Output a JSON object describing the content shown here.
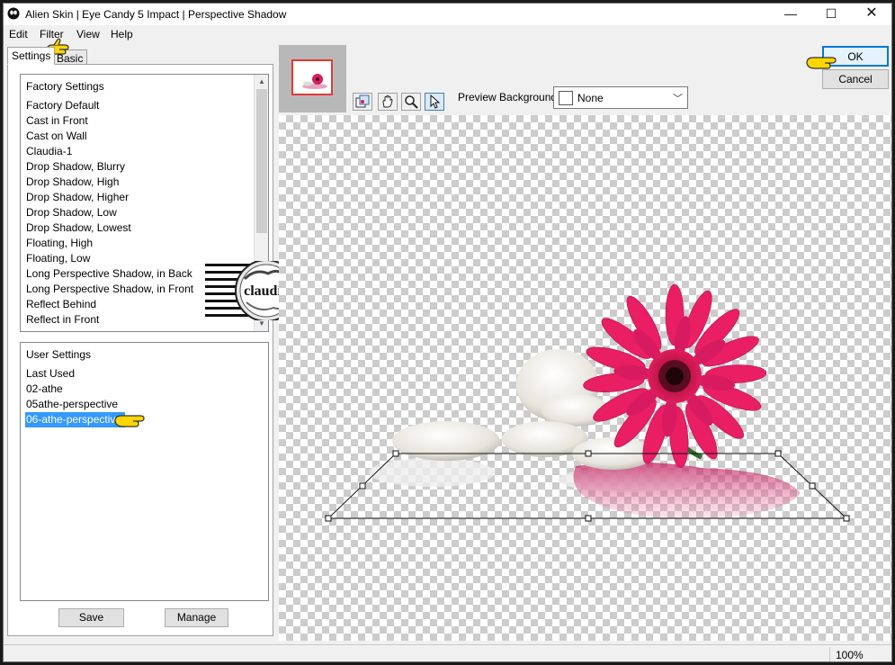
{
  "window": {
    "title": "Alien Skin | Eye Candy 5 Impact | Perspective Shadow",
    "minimize_glyph": "—",
    "maximize_glyph": "☐",
    "close_glyph": "✕"
  },
  "menu": {
    "items": [
      "Edit",
      "Filter",
      "View",
      "Help"
    ]
  },
  "tabs": [
    "Settings",
    "Basic"
  ],
  "factory_settings": {
    "header": "Factory Settings",
    "items": [
      "Factory Default",
      "Cast in Front",
      "Cast on Wall",
      "Claudia-1",
      "Drop Shadow, Blurry",
      "Drop Shadow, High",
      "Drop Shadow, Higher",
      "Drop Shadow, Low",
      "Drop Shadow, Lowest",
      "Floating, High",
      "Floating, Low",
      "Long Perspective Shadow, in Back",
      "Long Perspective Shadow, in Front",
      "Reflect Behind",
      "Reflect in Front"
    ]
  },
  "user_settings": {
    "header": "User Settings",
    "items": [
      "Last Used",
      "02-athe",
      "05athe-perspective",
      "06-athe-perspective"
    ],
    "selected": "06-athe-perspective"
  },
  "buttons": {
    "save": "Save",
    "manage": "Manage",
    "ok": "OK",
    "cancel": "Cancel"
  },
  "preview": {
    "background_label": "Preview Background:",
    "background_value": "None",
    "tools": [
      "pan-zoom-icon",
      "hand-icon",
      "zoom-icon",
      "pointer-icon"
    ]
  },
  "watermark": {
    "text": "claudia"
  },
  "status": {
    "zoom": "100%"
  },
  "colors": {
    "accent": "#0078d7",
    "selection": "#3399ff",
    "flower": "#d81b60"
  }
}
